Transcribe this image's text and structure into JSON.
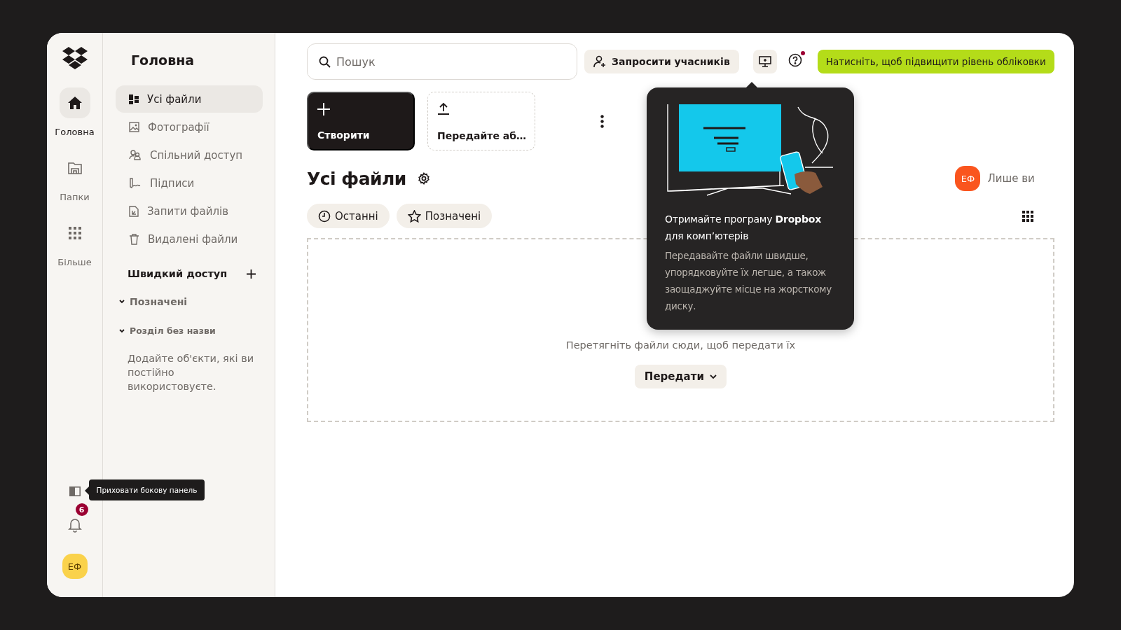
{
  "rail": {
    "items": [
      {
        "label": "Головна",
        "selected": true
      },
      {
        "label": "Папки",
        "selected": false
      },
      {
        "label": "Більше",
        "selected": false
      }
    ],
    "tooltip": "Приховати бокову панель",
    "notification_count": "6",
    "avatar": "ЕФ"
  },
  "sidebar": {
    "title": "Головна",
    "items": [
      {
        "label": "Усі файли",
        "selected": true
      },
      {
        "label": "Фотографії",
        "selected": false
      },
      {
        "label": "Спільний доступ",
        "selected": false
      },
      {
        "label": "Підписи",
        "selected": false
      },
      {
        "label": "Запити файлів",
        "selected": false
      },
      {
        "label": "Видалені файли",
        "selected": false
      }
    ],
    "quick_access": {
      "title": "Швидкий доступ",
      "sections": [
        {
          "label": "Позначені",
          "expanded": true
        },
        {
          "label": "Розділ без назви",
          "expanded": true
        }
      ],
      "hint": "Додайте об'єкти, які ви постійно використовуєте."
    }
  },
  "topbar": {
    "search": {
      "placeholder": "Пошук"
    },
    "invite_button": "Запросити учасників",
    "help_alert": true,
    "upgrade_button": "Натисніть, щоб підвищити рівень обліковки"
  },
  "actions": [
    {
      "kind": "create",
      "label": "Створити"
    },
    {
      "kind": "upload",
      "label": "Передайте аб…"
    }
  ],
  "content": {
    "title": "Усі файли",
    "access": {
      "avatar": "ЕФ",
      "label": "Лише ви"
    },
    "filters": [
      {
        "kind": "recent",
        "label": "Останні",
        "selected": false
      },
      {
        "kind": "starred",
        "label": "Позначені",
        "selected": false
      }
    ],
    "dropzone": {
      "text": "Перетягніть файли сюди, щоб передати їх",
      "button": "Передати"
    }
  },
  "popover": {
    "title": "Отримайте програму **Dropbox** для комп’ютерів",
    "body": "Передавайте файли швидше, упорядковуйте їх легше, а також заощаджуйте місце на жорсткому диску."
  }
}
